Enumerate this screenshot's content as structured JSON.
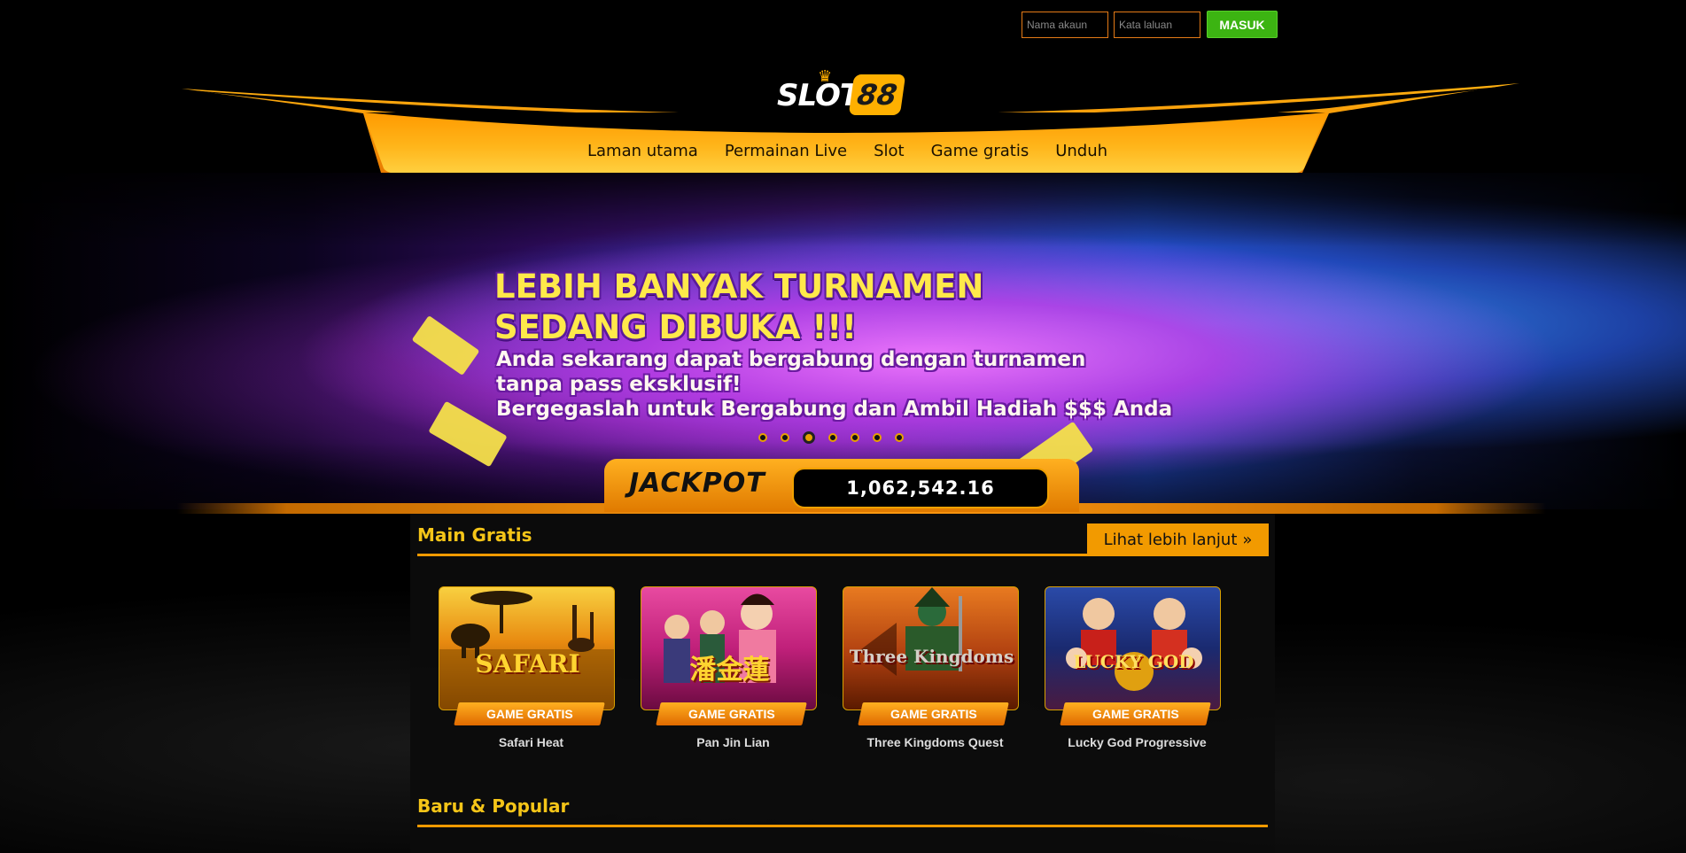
{
  "login": {
    "username_placeholder": "Nama akaun",
    "password_placeholder": "Kata laluan",
    "submit_label": "MASUK"
  },
  "logo": {
    "text": "SLOT",
    "number": "88"
  },
  "nav": {
    "items": [
      {
        "label": "Laman utama"
      },
      {
        "label": "Permainan Live"
      },
      {
        "label": "Slot"
      },
      {
        "label": "Game gratis"
      },
      {
        "label": "Unduh"
      }
    ]
  },
  "banner": {
    "title_line1": "LEBIH BANYAK TURNAMEN",
    "title_line2": "SEDANG DIBUKA !!!",
    "sub_line1": "Anda sekarang dapat bergabung dengan turnamen",
    "sub_line2": "tanpa pass eksklusif!",
    "sub_line3": "Bergegaslah untuk Bergabung dan Ambil Hadiah $$$ Anda",
    "slide_count": 7,
    "active_slide": 3
  },
  "jackpot": {
    "label": "JACKPOT",
    "value": "1,062,542.16"
  },
  "sections": {
    "main_gratis": {
      "title": "Main Gratis",
      "more_label": "Lihat lebih lanjut",
      "games": [
        {
          "art_title": "SAFARI",
          "tag": "GAME GRATIS",
          "name": "Safari Heat"
        },
        {
          "art_title": "潘金蓮",
          "tag": "GAME GRATIS",
          "name": "Pan Jin Lian"
        },
        {
          "art_title": "Three Kingdoms",
          "tag": "GAME GRATIS",
          "name": "Three Kingdoms Quest"
        },
        {
          "art_title": "LUCKY GOD",
          "tag": "GAME GRATIS",
          "name": "Lucky God Progressive"
        }
      ]
    },
    "baru_popular": {
      "title": "Baru & Popular"
    }
  },
  "colors": {
    "accent": "#f29a00",
    "login_button": "#3cb412",
    "section_title": "#f5c518"
  }
}
